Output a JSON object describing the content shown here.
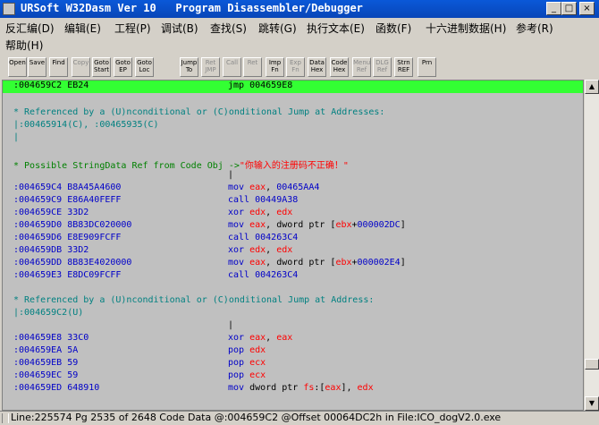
{
  "window": {
    "title": "URSoft W32Dasm Ver 10   Program Disassembler/Debugger",
    "buttons": {
      "minimize": "_",
      "maximize": "□",
      "close": "×"
    }
  },
  "menu": [
    "反汇编(D)",
    "编辑(E)",
    "工程(P)",
    "调试(B)",
    "查找(S)",
    "跳转(G)",
    "执行文本(E)",
    "函数(F)",
    "十六进制数据(H)",
    "参考(R)",
    "帮助(H)"
  ],
  "toolbar": [
    {
      "name": "open-file-button",
      "c1": "Open",
      "c2": "",
      "dis": false
    },
    {
      "name": "save-file-button",
      "c1": "Save",
      "c2": "",
      "dis": false
    },
    {
      "name": "find-text-button",
      "c1": "Find",
      "c2": "",
      "dis": false
    },
    {
      "name": "copy-lines-button",
      "c1": "Copy",
      "c2": "",
      "dis": true
    },
    {
      "name": "goto-start-button",
      "c1": "Goto",
      "c2": "Start",
      "dis": false
    },
    {
      "name": "goto-entry-point-button",
      "c1": "Goto",
      "c2": "EP",
      "dis": false
    },
    {
      "name": "goto-code-location-button",
      "c1": "Goto",
      "c2": "Loc",
      "dis": false
    },
    {
      "name": "jump-to-button",
      "c1": "Jump",
      "c2": "To",
      "dis": false
    },
    {
      "name": "return-from-jump-button",
      "c1": "Ret",
      "c2": "JMP",
      "dis": true
    },
    {
      "name": "execute-call-button",
      "c1": "Call",
      "c2": "",
      "dis": true
    },
    {
      "name": "return-from-call-button",
      "c1": "Ret",
      "c2": "",
      "dis": true
    },
    {
      "name": "imports-button",
      "c1": "Imp",
      "c2": "Fn",
      "dis": false
    },
    {
      "name": "exports-button",
      "c1": "Exp",
      "c2": "Fn",
      "dis": true
    },
    {
      "name": "data-hex-button",
      "c1": "Data",
      "c2": "Hex",
      "dis": false
    },
    {
      "name": "code-hex-button",
      "c1": "Code",
      "c2": "Hex",
      "dis": false
    },
    {
      "name": "menu-ref-button",
      "c1": "Menu",
      "c2": "Ref",
      "dis": true
    },
    {
      "name": "dialog-ref-button",
      "c1": "DLG",
      "c2": "Ref",
      "dis": true
    },
    {
      "name": "string-ref-button",
      "c1": "Strn",
      "c2": "REF",
      "dis": false
    },
    {
      "name": "print-button",
      "c1": "Prn",
      "c2": "",
      "dis": false
    }
  ],
  "listing": {
    "highlight": {
      "addr": ":004659C2 EB24",
      "mn": "jmp 004659E8"
    },
    "ref1": "* Referenced by a (U)nconditional or (C)onditional Jump at Addresses:",
    "ref1_addrs": "|:00465914(C), :00465935(C)",
    "pipe": "|",
    "string_ref": "* Possible StringData Ref from Code Obj ->",
    "string_val": "\"你输入的注册码不正确！\"",
    "lines1": [
      {
        "a": ":004659C4 B8A45A4600",
        "m": "mov",
        "o": [
          [
            "rg",
            "eax"
          ],
          [
            "pp",
            ", "
          ],
          [
            "mn",
            "00465AA4"
          ]
        ]
      },
      {
        "a": ":004659C9 E86A40FEFF",
        "m": "call",
        "o": [
          [
            "mn",
            "00449A38"
          ]
        ]
      },
      {
        "a": ":004659CE 33D2",
        "m": "xor",
        "o": [
          [
            "rg",
            "edx"
          ],
          [
            "pp",
            ", "
          ],
          [
            "rg",
            "edx"
          ]
        ]
      },
      {
        "a": ":004659D0 8B83DC020000",
        "m": "mov",
        "o": [
          [
            "rg",
            "eax"
          ],
          [
            "pp",
            ", dword ptr ["
          ],
          [
            "rg",
            "ebx"
          ],
          [
            "pp",
            "+"
          ],
          [
            "mn",
            "000002DC"
          ],
          [
            "pp",
            "]"
          ]
        ]
      },
      {
        "a": ":004659D6 E8E909FCFF",
        "m": "call",
        "o": [
          [
            "mn",
            "004263C4"
          ]
        ]
      },
      {
        "a": ":004659DB 33D2",
        "m": "xor",
        "o": [
          [
            "rg",
            "edx"
          ],
          [
            "pp",
            ", "
          ],
          [
            "rg",
            "edx"
          ]
        ]
      },
      {
        "a": ":004659DD 8B83E4020000",
        "m": "mov",
        "o": [
          [
            "rg",
            "eax"
          ],
          [
            "pp",
            ", dword ptr ["
          ],
          [
            "rg",
            "ebx"
          ],
          [
            "pp",
            "+"
          ],
          [
            "mn",
            "000002E4"
          ],
          [
            "pp",
            "]"
          ]
        ]
      },
      {
        "a": ":004659E3 E8DC09FCFF",
        "m": "call",
        "o": [
          [
            "mn",
            "004263C4"
          ]
        ]
      }
    ],
    "ref2": "* Referenced by a (U)nconditional or (C)onditional Jump at Address:",
    "ref2_addrs": "|:004659C2(U)",
    "lines2": [
      {
        "a": ":004659E8 33C0",
        "m": "xor",
        "o": [
          [
            "rg",
            "eax"
          ],
          [
            "pp",
            ", "
          ],
          [
            "rg",
            "eax"
          ]
        ]
      },
      {
        "a": ":004659EA 5A",
        "m": "pop",
        "o": [
          [
            "rg",
            "edx"
          ]
        ]
      },
      {
        "a": ":004659EB 59",
        "m": "pop",
        "o": [
          [
            "rg",
            "ecx"
          ]
        ]
      },
      {
        "a": ":004659EC 59",
        "m": "pop",
        "o": [
          [
            "rg",
            "ecx"
          ]
        ]
      },
      {
        "a": ":004659ED 648910",
        "m": "mov",
        "o": [
          [
            "pp",
            "dword ptr "
          ],
          [
            "rg",
            "fs"
          ],
          [
            "pp",
            ":["
          ],
          [
            "rg",
            "eax"
          ],
          [
            "pp",
            "], "
          ],
          [
            "rg",
            "edx"
          ]
        ]
      }
    ]
  },
  "status": "Line:225574 Pg 2535 of 2648  Code Data @:004659C2 @Offset 00064DC2h in File:ICO_dogV2.0.exe",
  "colors": {
    "highlight": "#33ff33",
    "address": "#0000c8",
    "register": "#ff0000",
    "comment": "#008080",
    "string_ref": "#008000"
  }
}
